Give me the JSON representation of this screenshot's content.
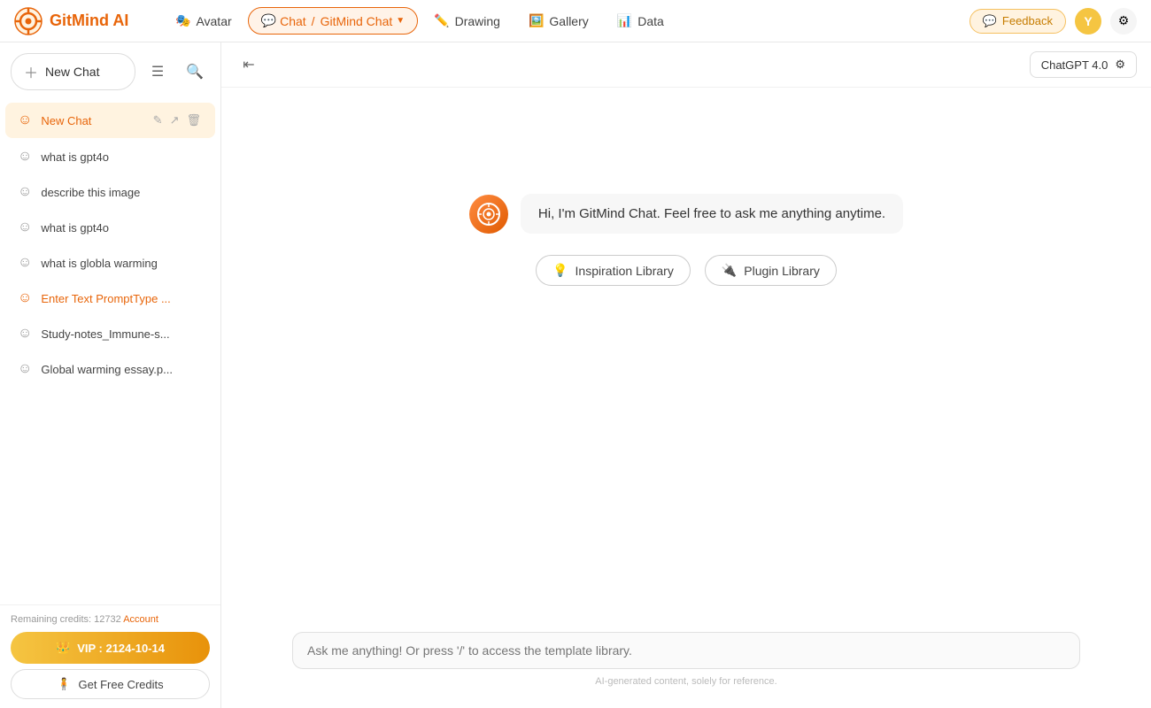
{
  "app": {
    "name": "GitMind AI"
  },
  "topnav": {
    "logo_text": "GitMind AI",
    "nav_items": [
      {
        "id": "avatar",
        "label": "Avatar",
        "icon": "🎭",
        "active": false
      },
      {
        "id": "chat",
        "label": "Chat",
        "icon": "💬",
        "active": true
      },
      {
        "id": "gitmind-chat",
        "label": "GitMind Chat",
        "icon": "",
        "active": true
      },
      {
        "id": "drawing",
        "label": "Drawing",
        "icon": "✏️",
        "active": false
      },
      {
        "id": "gallery",
        "label": "Gallery",
        "icon": "🖼️",
        "active": false
      },
      {
        "id": "data",
        "label": "Data",
        "icon": "📊",
        "active": false
      }
    ],
    "feedback_label": "Feedback",
    "avatar_initials": "Y",
    "model_label": "ChatGPT 4.0"
  },
  "sidebar": {
    "new_chat_label": "New Chat",
    "chat_list": [
      {
        "id": "new-chat",
        "label": "New Chat",
        "active": true
      },
      {
        "id": "what-is-gpt4o-1",
        "label": "what is gpt4o"
      },
      {
        "id": "describe-image",
        "label": "describe this image"
      },
      {
        "id": "what-is-gpt4o-2",
        "label": "what is gpt4o"
      },
      {
        "id": "global-warming",
        "label": "what is globla warming"
      },
      {
        "id": "enter-text-prompt",
        "label": "Enter Text PromptType ..."
      },
      {
        "id": "study-notes",
        "label": "Study-notes_Immune-s..."
      },
      {
        "id": "global-warming-essay",
        "label": "Global warming essay.p..."
      }
    ],
    "credits_label": "Remaining credits: 12732",
    "account_label": "Account",
    "vip_label": "VIP : 2124-10-14",
    "free_credits_label": "Get Free Credits"
  },
  "chat": {
    "greeting": "Hi, I'm GitMind Chat. Feel free to ask me anything anytime.",
    "inspiration_library_label": "Inspiration Library",
    "plugin_library_label": "Plugin Library",
    "input_placeholder": "Ask me anything! Or press '/' to access the template library.",
    "footer_note": "AI-generated content, solely for reference.",
    "model_label": "ChatGPT 4.0"
  }
}
